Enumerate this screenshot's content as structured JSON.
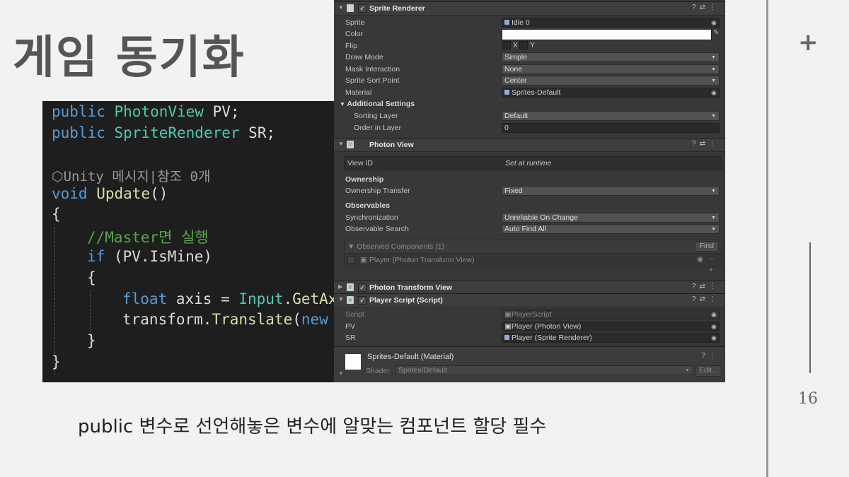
{
  "slide": {
    "title": "게임 동기화",
    "caption": "public 변수로 선언해놓은 변수에 알맞는 컴포넌트 할당 필수",
    "page_number": "16",
    "plus_icon": "+"
  },
  "code": {
    "line1_kw": "public",
    "line1_type": "PhotonView",
    "line1_rest": " PV;",
    "line2_kw": "public",
    "line2_type": "SpriteRenderer",
    "line2_rest": " SR;",
    "ref_hint": "Unity 메시지|참조 0개",
    "line4_kw": "void",
    "line4_fn": "Update",
    "line4_rest": "()",
    "brace_open": "{",
    "comment": "//Master면 실행",
    "if_kw": "if",
    "if_rest": " (PV.IsMine)",
    "inner_open": "{",
    "float_kw": "float",
    "axis_rest": " axis = ",
    "input_type": "Input",
    "getaxis": ".GetAx",
    "translate_pre": "transform.",
    "translate_fn": "Translate",
    "translate_paren": "(",
    "new_kw": "new",
    "inner_close": "}",
    "brace_close": "}"
  },
  "inspector": {
    "sprite_renderer": {
      "header": "Sprite Renderer",
      "sprite_label": "Sprite",
      "sprite_value": "Idle 0",
      "color_label": "Color",
      "flip_label": "Flip",
      "flip_x": "X",
      "flip_y": "Y",
      "draw_mode_label": "Draw Mode",
      "draw_mode_value": "Simple",
      "mask_label": "Mask Interaction",
      "mask_value": "None",
      "sort_point_label": "Sprite Sort Point",
      "sort_point_value": "Center",
      "material_label": "Material",
      "material_value": "Sprites-Default",
      "additional_label": "Additional Settings",
      "sorting_layer_label": "Sorting Layer",
      "sorting_layer_value": "Default",
      "order_label": "Order in Layer",
      "order_value": "0"
    },
    "photon_view": {
      "header": "Photon View",
      "view_id_label": "View ID",
      "view_id_value": "Set at runtime",
      "ownership_label": "Ownership",
      "ownership_transfer_label": "Ownership Transfer",
      "ownership_transfer_value": "Fixed",
      "observables_label": "Observables",
      "sync_label": "Synchronization",
      "sync_value": "Unreliable On Change",
      "observable_search_label": "Observable Search",
      "observable_search_value": "Auto Find All",
      "observed_components_label": "Observed Components (1)",
      "find_button": "Find",
      "observed_item": "Player (Photon Transform View)",
      "minus": "–",
      "plus": "+"
    },
    "photon_transform_view": {
      "header": "Photon Transform View"
    },
    "player_script": {
      "header": "Player Script (Script)",
      "script_label": "Script",
      "script_value": "PlayerScript",
      "pv_label": "PV",
      "pv_value": "Player (Photon View)",
      "sr_label": "SR",
      "sr_value": "Player (Sprite Renderer)"
    },
    "material": {
      "name": "Sprites-Default (Material)",
      "shader_label": "Shader",
      "shader_value": "Sprites/Default",
      "edit_button": "Edit..."
    }
  }
}
